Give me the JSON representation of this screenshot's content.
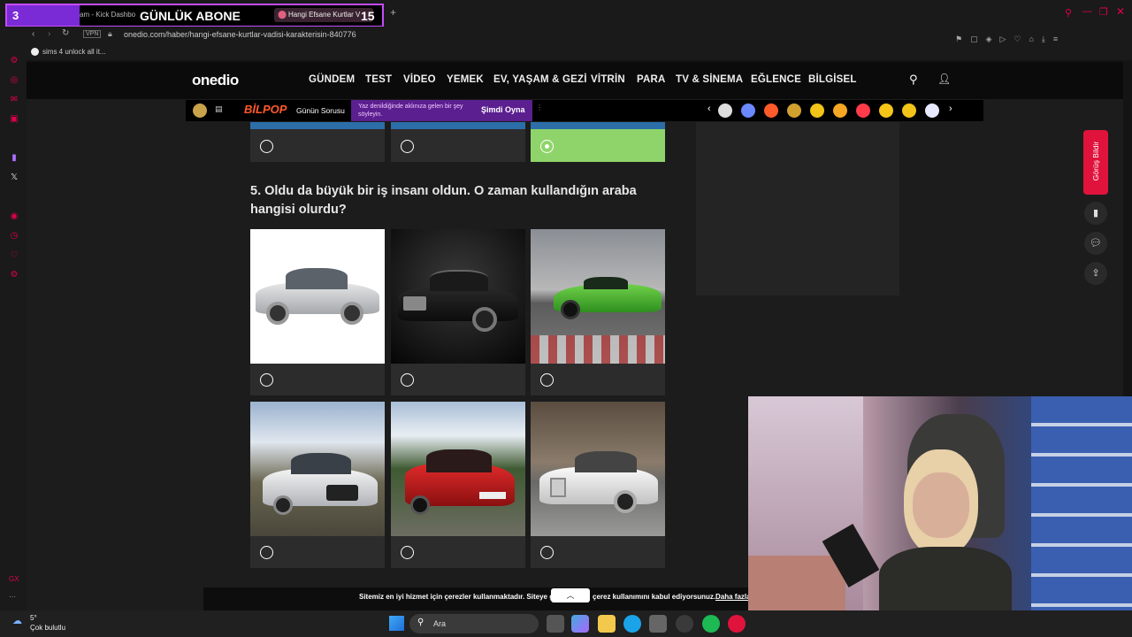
{
  "overlay": {
    "counter": "3",
    "subs_label": "GÜNLÜK ABONE",
    "subs_count": "15"
  },
  "tabs": [
    {
      "label": "am - Kick Dashbo"
    },
    {
      "label": "Hangi Efsane Kurtlar V"
    }
  ],
  "address": {
    "url": "onedio.com/haber/hangi-efsane-kurtlar-vadisi-karakterisin-840776",
    "vpn": "VPN"
  },
  "bookmarks": [
    {
      "label": "sims 4 unlock all it..."
    }
  ],
  "site": {
    "logo": "onedio",
    "nav": [
      "GÜNDEM",
      "TEST",
      "VİDEO",
      "YEMEK",
      "EV, YAŞAM & GEZİ",
      "VİTRİN",
      "PARA",
      "TV & SİNEMA",
      "EĞLENCE",
      "BİLGİSEL"
    ]
  },
  "subbar": {
    "brand": "BİLPOP",
    "daily": "Günün Sorusu",
    "promo": "Yaz denildiğinde aklınıza gelen bir şey söyleyin.",
    "play": "Şimdi Oyna"
  },
  "question": {
    "text": "5. Oldu da büyük bir iş insanı oldun. O zaman kullandığın araba hangisi olurdu?"
  },
  "side": {
    "feedback": "Görüş Bildir"
  },
  "cookie": {
    "text": "Sitemiz en iyi hizmet için çerezler kullanmaktadır. Siteye gir",
    "text2": "çerez kullanımını kabul ediyorsunuz.",
    "link": "Daha fazla"
  },
  "taskbar": {
    "weather_temp": "5°",
    "weather_text": "Çok bulutlu",
    "search": "Ara"
  },
  "colors": {
    "accent": "#e0004d",
    "selected": "#8fd46a",
    "card": "#2c2c2c"
  }
}
